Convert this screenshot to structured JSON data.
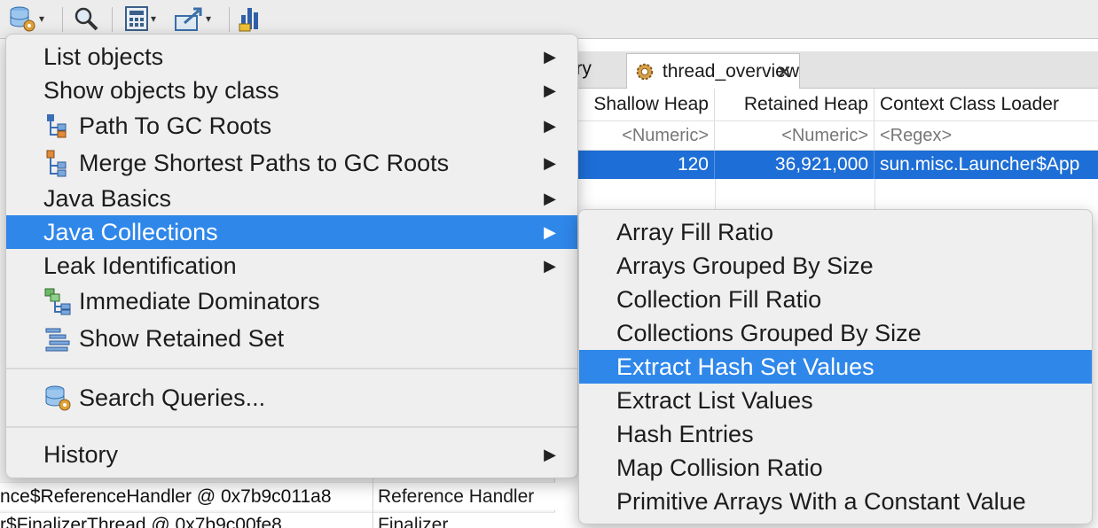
{
  "toolbar": {
    "buttons": [
      {
        "name": "query-browser-button",
        "icon": "database-gear-icon",
        "has_dropdown": true
      },
      {
        "name": "search-button",
        "icon": "magnifier-icon",
        "has_dropdown": false
      },
      {
        "name": "calculator-button",
        "icon": "calculator-icon",
        "has_dropdown": true
      },
      {
        "name": "export-button",
        "icon": "export-icon",
        "has_dropdown": true
      },
      {
        "name": "histogram-button",
        "icon": "histogram-icon",
        "has_dropdown": false
      }
    ]
  },
  "left_pane": {
    "rows": [
      {
        "text": "nce$ReferenceHandler @ 0x7b9c011a8",
        "name": "Reference Handler"
      },
      {
        "text": "r$FinalizerThread @ 0x7b9c00fe8",
        "name": "Finalizer"
      }
    ]
  },
  "editor": {
    "inactive_tab_label": "uery",
    "active_tab_label": "thread_overview",
    "columns": [
      "Shallow Heap",
      "Retained Heap",
      "Context Class Loader"
    ],
    "filters": [
      "<Numeric>",
      "<Numeric>",
      "<Regex>"
    ],
    "selected_row": {
      "shallow": "120",
      "retained": "36,921,000",
      "loader": "sun.misc.Launcher$App"
    }
  },
  "context_menu": {
    "items": [
      {
        "label": "List objects",
        "submenu": true,
        "icon": null
      },
      {
        "label": "Show objects by class",
        "submenu": true,
        "icon": null
      },
      {
        "label": "Path To GC Roots",
        "submenu": true,
        "icon": "path-tree-icon"
      },
      {
        "label": "Merge Shortest Paths to GC Roots",
        "submenu": true,
        "icon": "merge-paths-icon"
      },
      {
        "label": "Java Basics",
        "submenu": true,
        "icon": null
      },
      {
        "label": "Java Collections",
        "submenu": true,
        "icon": null,
        "highlighted": true
      },
      {
        "label": "Leak Identification",
        "submenu": true,
        "icon": null
      },
      {
        "label": "Immediate Dominators",
        "submenu": false,
        "icon": "dominators-icon"
      },
      {
        "label": "Show Retained Set",
        "submenu": false,
        "icon": "retained-set-icon"
      }
    ],
    "search_label": "Search Queries...",
    "history_label": "History"
  },
  "submenu": {
    "items": [
      "Array Fill Ratio",
      "Arrays Grouped By Size",
      "Collection Fill Ratio",
      "Collections Grouped By Size",
      "Extract Hash Set Values",
      "Extract List Values",
      "Hash Entries",
      "Map Collision Ratio",
      "Primitive Arrays With a Constant Value"
    ],
    "highlighted_index": 4
  },
  "colors": {
    "highlight": "#2f87ea",
    "selection": "#1d6ed6"
  }
}
